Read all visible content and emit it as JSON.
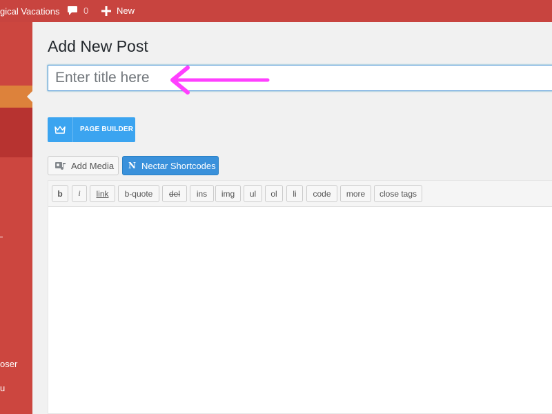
{
  "admin_bar": {
    "site_name": "gical Vacations",
    "comments_count": "0",
    "new_label": "New"
  },
  "sidebar": {
    "partial_items": [
      "oser",
      "u"
    ]
  },
  "page": {
    "title": "Add New Post",
    "title_placeholder": "Enter title here"
  },
  "page_builder": {
    "label": "PAGE BUILDER"
  },
  "media_buttons": {
    "add_media": "Add Media",
    "nectar_shortcodes": "Nectar Shortcodes"
  },
  "quicktags": [
    "b",
    "i",
    "link",
    "b-quote",
    "del",
    "ins",
    "img",
    "ul",
    "ol",
    "li",
    "code",
    "more",
    "close tags"
  ],
  "annotation": {
    "arrow_color": "#ff40ff"
  },
  "colors": {
    "admin_bar": "#c8443f",
    "sidebar": "#cc463f",
    "sidebar_active": "#dd823b",
    "page_builder": "#3ba4f0",
    "nectar_button": "#3a91db"
  }
}
